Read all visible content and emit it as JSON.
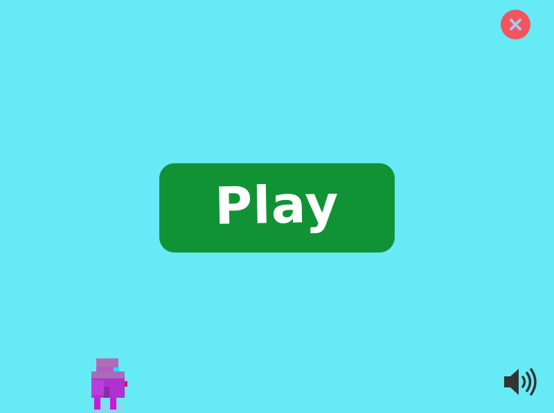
{
  "game": {
    "play_label": "Play"
  },
  "icons": {
    "close": "close-icon",
    "sound": "speaker-volume-icon"
  },
  "colors": {
    "background": "#66eaf5",
    "play_button": "#119335",
    "play_text": "#ffffff",
    "close_button": "#f2555f",
    "close_cross": "#a8c8ee",
    "sound_icon": "#333333",
    "character_body": "#b130d0",
    "character_head": "#ad6fb4",
    "character_eye": "#20dfff",
    "character_accent": "#e01060"
  }
}
